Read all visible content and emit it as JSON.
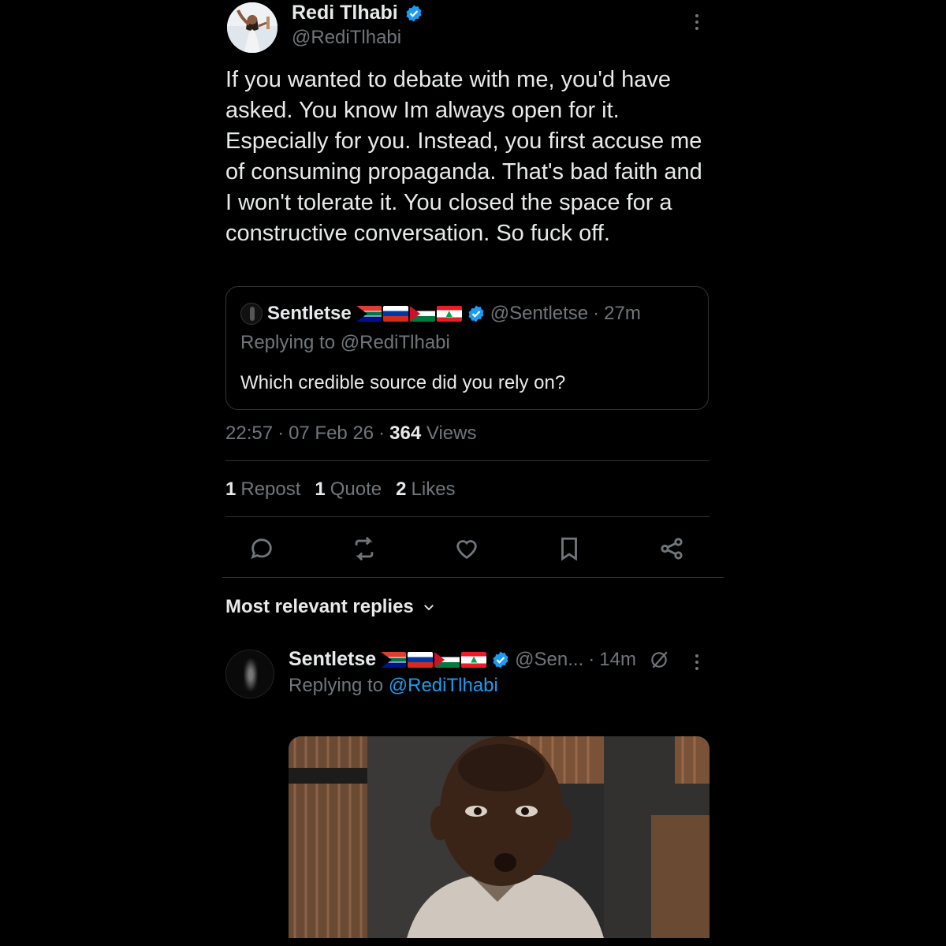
{
  "post": {
    "author_name": "Redi Tlhabi",
    "author_handle": "@RediTlhabi",
    "text": "If you wanted to debate with me, you'd have asked. You know Im always open for it. Especially for you. Instead, you first accuse me of consuming propaganda. That's bad faith and I won't tolerate it. You closed the space for a constructive conversation. So fuck off.",
    "time": "22:57",
    "date": "07 Feb 26",
    "views_count": "364",
    "views_label": "Views",
    "stats": {
      "reposts_count": "1",
      "reposts_label": "Repost",
      "quotes_count": "1",
      "quotes_label": "Quote",
      "likes_count": "2",
      "likes_label": "Likes"
    }
  },
  "quoted": {
    "author_name": "Sentletse",
    "author_handle": "@Sentletse",
    "age": "27m",
    "replying_prefix": "Replying to",
    "replying_handle": "@RediTlhabi",
    "text": "Which credible source did you rely on?"
  },
  "replies_header": {
    "label": "Most relevant replies"
  },
  "reply": {
    "author_name": "Sentletse",
    "author_handle": "@Sen...",
    "age": "14m",
    "replying_prefix": "Replying to",
    "replying_handle": "@RediTlhabi"
  },
  "icons": [
    "verified-icon",
    "more-icon",
    "reply-icon",
    "repost-icon",
    "like-icon",
    "bookmark-icon",
    "share-icon",
    "chevron-down-icon",
    "grok-icon"
  ],
  "colors": {
    "background": "#000000",
    "text": "#e7e9ea",
    "secondary": "#71767b",
    "link": "#1d9bf0",
    "verified": "#1d9bf0",
    "border": "#2f3336"
  }
}
